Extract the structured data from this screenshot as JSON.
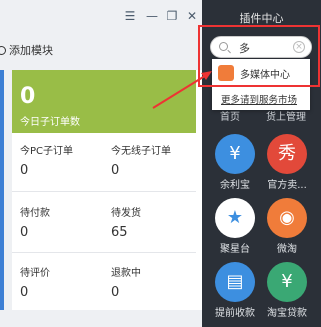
{
  "window": {
    "controls": [
      "☰",
      "—",
      "❐",
      "✕"
    ]
  },
  "main": {
    "add_module": "添加模块",
    "summary_value": "0",
    "summary_label": "今日子订单数",
    "stats": [
      {
        "label": "今PC子订单",
        "value": "0"
      },
      {
        "label": "今无线子订单",
        "value": "0"
      },
      {
        "label": "待付款",
        "value": "0"
      },
      {
        "label": "待发货",
        "value": "65"
      },
      {
        "label": "待评价",
        "value": "0"
      },
      {
        "label": "退款中",
        "value": "0"
      }
    ]
  },
  "sidebar": {
    "title": "插件中心",
    "search_value": "多",
    "suggestion": "多媒体中心",
    "more_link": "更多请到服务市场",
    "partial_labels": [
      "首页",
      "货上管理"
    ],
    "apps": [
      {
        "label": "余利宝",
        "color": "#3d8fe0",
        "glyph": "¥"
      },
      {
        "label": "官方卖...",
        "color": "#e2493a",
        "glyph": "秀"
      },
      {
        "label": "聚星台",
        "color": "#ffffff",
        "glyph": "★"
      },
      {
        "label": "微淘",
        "color": "#f07c3a",
        "glyph": "◉"
      },
      {
        "label": "提前收款",
        "color": "#3d8fe0",
        "glyph": "▤"
      },
      {
        "label": "淘宝贷款",
        "color": "#3aa874",
        "glyph": "¥"
      }
    ]
  }
}
